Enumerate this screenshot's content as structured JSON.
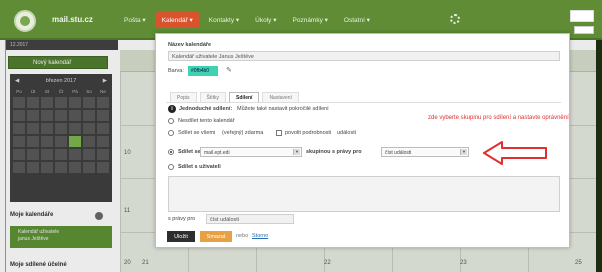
{
  "header": {
    "site_name": "mail.stu.cz",
    "nav": [
      "Pošta ▾",
      "Kalendář ▾",
      "Kontakty ▾",
      "Úkoly ▾",
      "Poznámky ▾",
      "Ostatní ▾"
    ],
    "active_index": 1
  },
  "sidebar": {
    "date_bar": "12.2017",
    "new_calendar": "Nový kalendář",
    "minical_month": "březen 2017",
    "weekdays": [
      "Po",
      "Út",
      "St",
      "Čt",
      "Pá",
      "So",
      "Ne"
    ],
    "my_calendars": "Moje kalendáře",
    "calendar_item": "Kalendář uživatele\njanus Ještěve",
    "shared_calendars": "Moje sdílené účelné"
  },
  "calendar": {
    "numbers": [
      "10",
      "11",
      "20",
      "21",
      "22",
      "23",
      "25"
    ]
  },
  "modal": {
    "name_label": "Název kalendáře",
    "name_value": "Kalendář uživatele Janus Ještěve",
    "color_label": "Barva:",
    "color_value": "#0fb4b0",
    "tabs": [
      "Popis",
      "Štítky",
      "Sdílení",
      "Nastavení"
    ],
    "active_tab": 2,
    "simple_sharing": "Jednoduché sdílení:",
    "simple_sharing_rest": "Můžete také nastavit pokročilé sdílení",
    "option_noshare": "Nesdílet tento kalendář",
    "option_all": "Sdílet se všemi",
    "option_all_extra": "(veřejný) zdarma",
    "option_advanced_check": "povolit podrobnosti",
    "option_advanced_rest": "událostí",
    "option_group": "Sdílet se",
    "group_select": "mail.ept.edi",
    "group_label": "skupinou s právy pro",
    "rights_select": "číst události",
    "option_user": "Sdílet s uživateli",
    "rights_label": "s právy pro",
    "rights_value": "číst události",
    "btn_save": "Uložit",
    "btn_delete": "Smazat",
    "link_or": "nebo",
    "link_cancel": "Storno"
  },
  "annotation": {
    "text": "zde vyberte skupinu pro sdílení a nastavte oprávnění",
    "color": "#e0302f"
  }
}
